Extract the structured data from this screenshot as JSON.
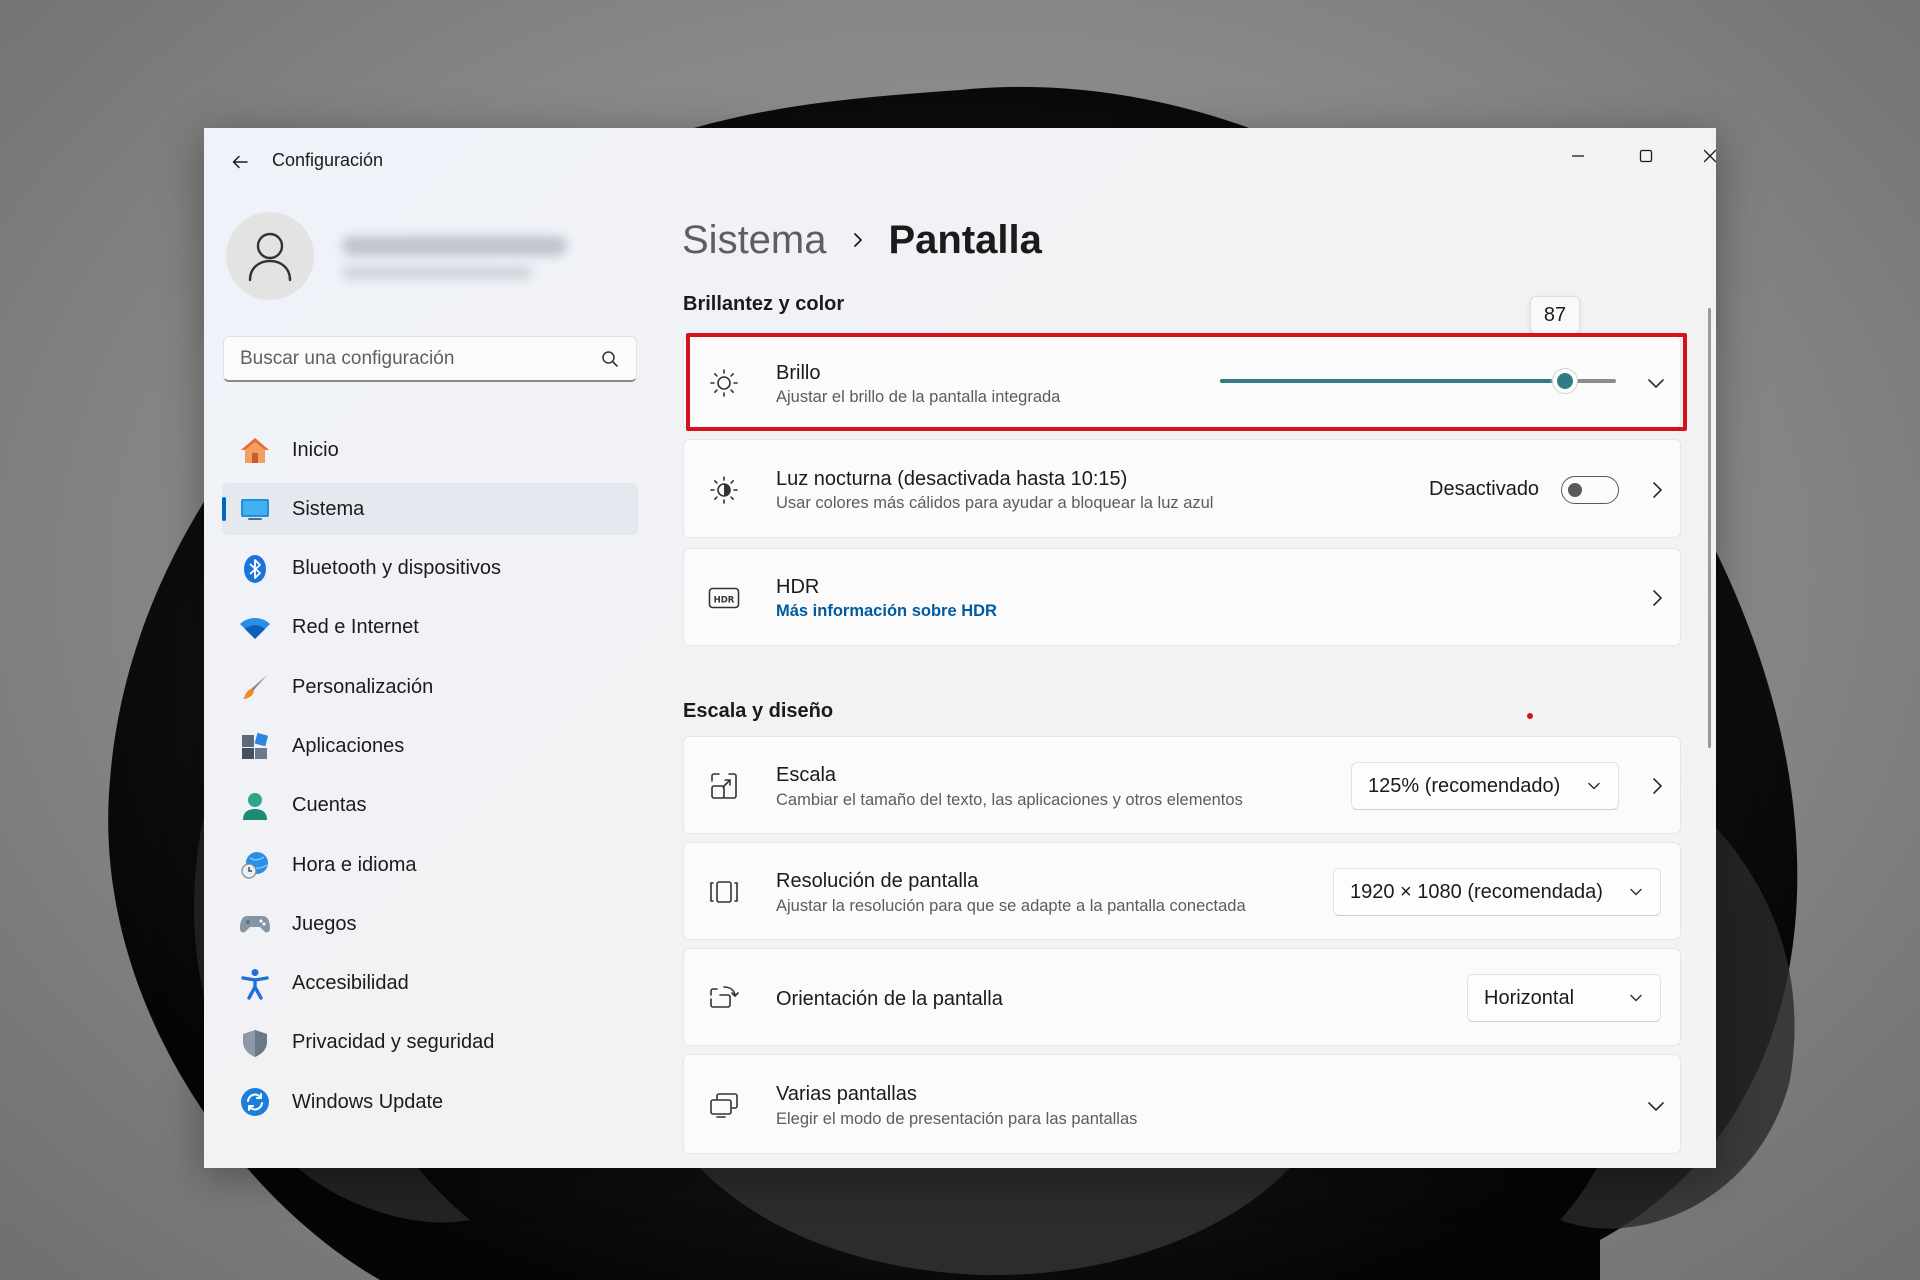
{
  "window": {
    "app_title": "Configuración"
  },
  "search": {
    "placeholder": "Buscar una configuración"
  },
  "sidebar": {
    "items": [
      {
        "label": "Inicio",
        "icon": "home-icon"
      },
      {
        "label": "Sistema",
        "icon": "system-icon",
        "active": true
      },
      {
        "label": "Bluetooth y dispositivos",
        "icon": "bluetooth-icon"
      },
      {
        "label": "Red e Internet",
        "icon": "wifi-icon"
      },
      {
        "label": "Personalización",
        "icon": "brush-icon"
      },
      {
        "label": "Aplicaciones",
        "icon": "apps-icon"
      },
      {
        "label": "Cuentas",
        "icon": "accounts-icon"
      },
      {
        "label": "Hora e idioma",
        "icon": "time-language-icon"
      },
      {
        "label": "Juegos",
        "icon": "gamepad-icon"
      },
      {
        "label": "Accesibilidad",
        "icon": "accessibility-icon"
      },
      {
        "label": "Privacidad y seguridad",
        "icon": "shield-icon"
      },
      {
        "label": "Windows Update",
        "icon": "update-icon"
      }
    ]
  },
  "breadcrumb": {
    "parent": "Sistema",
    "current": "Pantalla"
  },
  "sections": {
    "brightness_color": "Brillantez y color",
    "scale_layout": "Escala y diseño"
  },
  "brightness": {
    "title": "Brillo",
    "subtitle": "Ajustar el brillo de la pantalla integrada",
    "value": 87,
    "value_label": "87"
  },
  "night_light": {
    "title": "Luz nocturna (desactivada hasta 10:15)",
    "subtitle": "Usar colores más cálidos para ayudar a bloquear la luz azul",
    "state_label": "Desactivado",
    "on": false
  },
  "hdr": {
    "title": "HDR",
    "link": "Más información sobre HDR"
  },
  "scale": {
    "title": "Escala",
    "subtitle": "Cambiar el tamaño del texto, las aplicaciones y otros elementos",
    "value": "125% (recomendado)"
  },
  "resolution": {
    "title": "Resolución de pantalla",
    "subtitle": "Ajustar la resolución para que se adapte a la pantalla conectada",
    "value": "1920 × 1080 (recomendada)"
  },
  "orientation": {
    "title": "Orientación de la pantalla",
    "value": "Horizontal"
  },
  "multi_display": {
    "title": "Varias pantallas",
    "subtitle": "Elegir el modo de presentación para las pantallas"
  },
  "colors": {
    "accent": "#0067c0",
    "slider": "#2f7b86",
    "highlight": "#d4111d",
    "link": "#005a9e"
  }
}
